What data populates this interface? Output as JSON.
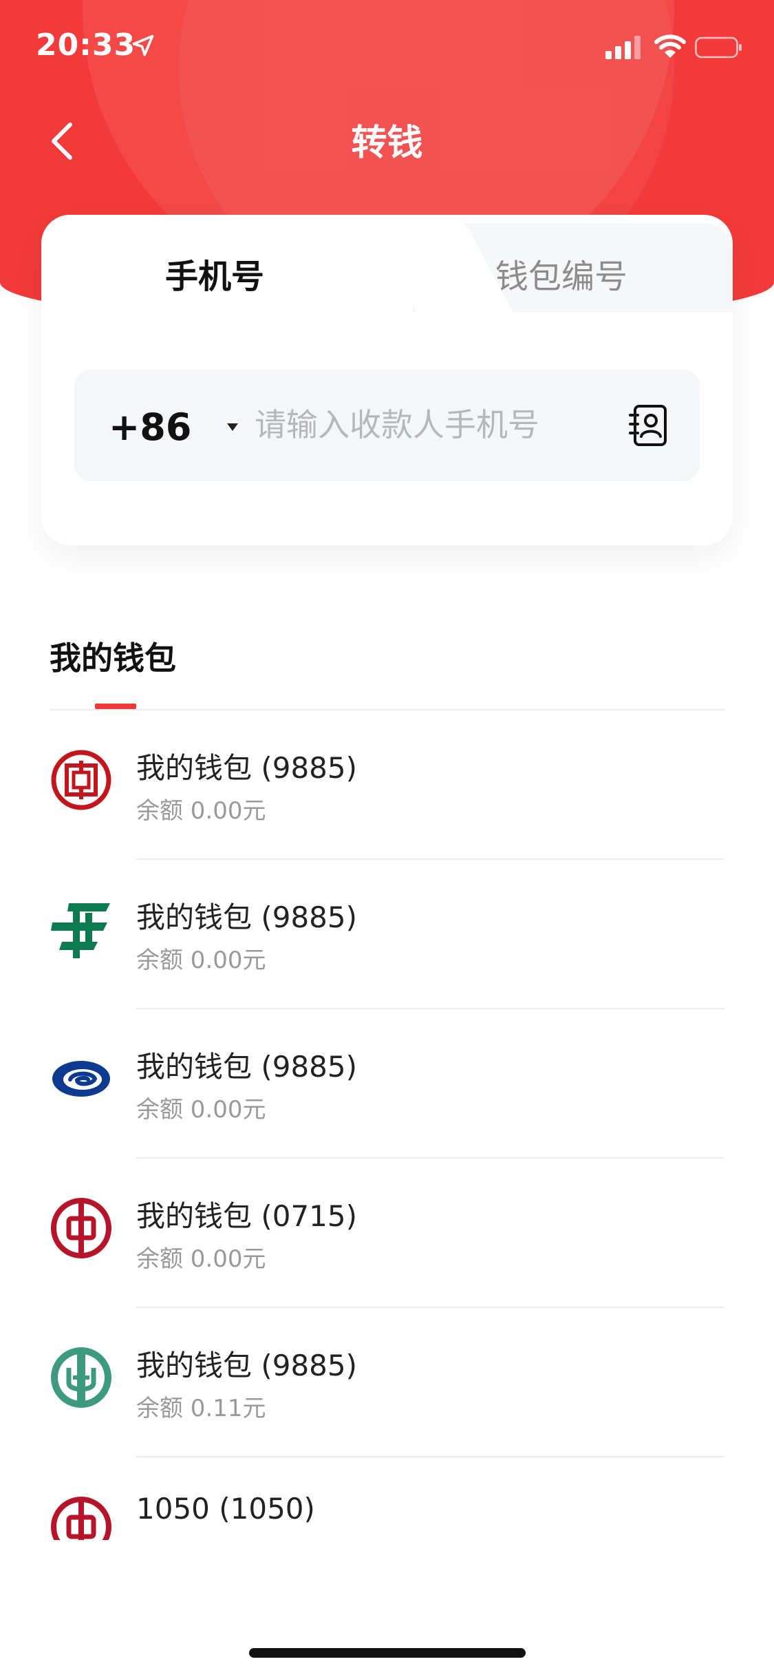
{
  "status_bar": {
    "time": "20:33"
  },
  "nav": {
    "title": "转钱"
  },
  "tabs": [
    {
      "label": "手机号",
      "active": true
    },
    {
      "label": "钱包编号",
      "active": false
    }
  ],
  "phone_input": {
    "country_code": "+86",
    "placeholder": "请输入收款人手机号",
    "value": ""
  },
  "section": {
    "title": "我的钱包"
  },
  "wallets": [
    {
      "name": "我的钱包 (9885)",
      "balance": "余额 0.00元",
      "logo": "icbc-logo",
      "color": "#c3161c"
    },
    {
      "name": "我的钱包 (9885)",
      "balance": "余额 0.00元",
      "logo": "postal-savings-logo",
      "color": "#0e7a52"
    },
    {
      "name": "我的钱包 (9885)",
      "balance": "余额 0.00元",
      "logo": "china-unionpay-swirl-logo",
      "color": "#0d3a8f"
    },
    {
      "name": "我的钱包 (0715)",
      "balance": "余额 0.00元",
      "logo": "bank-of-china-logo",
      "color": "#b5142b"
    },
    {
      "name": "我的钱包 (9885)",
      "balance": "余额 0.11元",
      "logo": "agricultural-bank-logo",
      "color": "#3d9a7f"
    },
    {
      "name": "1050 (1050)",
      "balance": "",
      "logo": "bank-of-china-logo",
      "color": "#b5142b"
    }
  ],
  "colors": {
    "brand_red": "#f23a3a",
    "indicator": "#f03a3a"
  }
}
